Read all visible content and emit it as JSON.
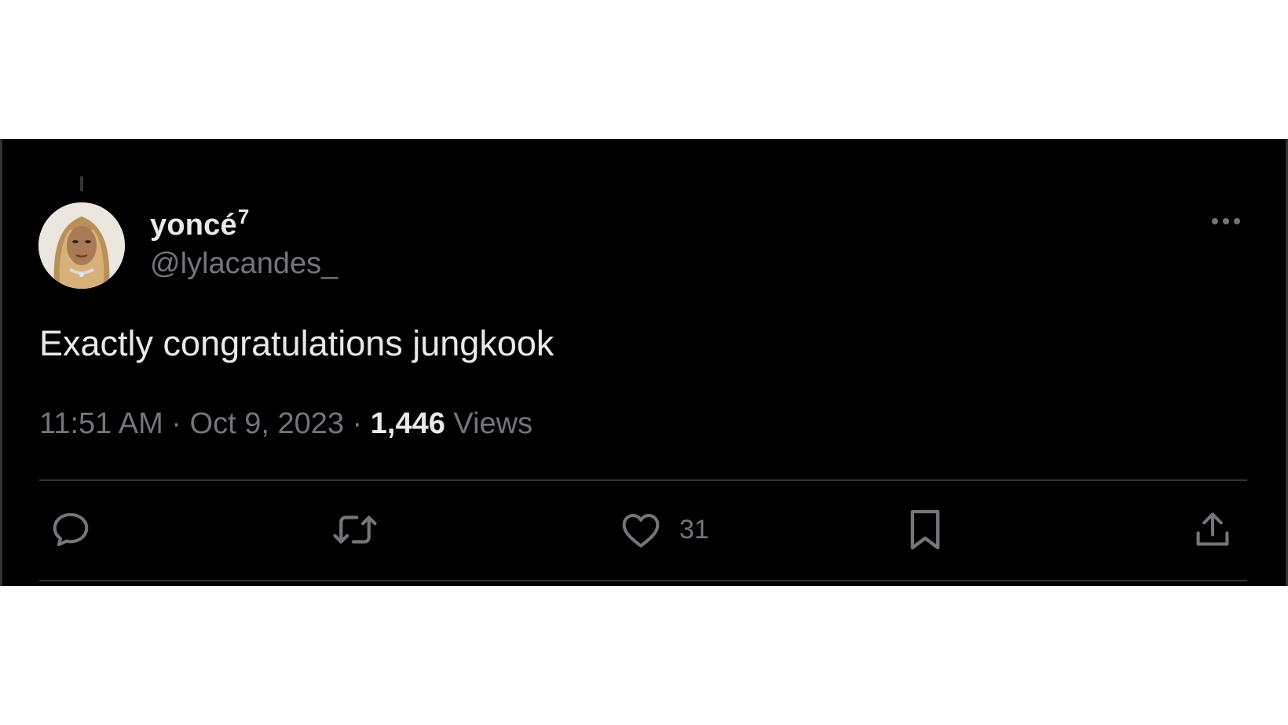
{
  "tweet": {
    "display_name": "yoncé",
    "display_name_superscript": "7",
    "handle": "@lylacandes_",
    "text": "Exactly congratulations jungkook",
    "time": "11:51 AM",
    "date": "Oct 9, 2023",
    "views_count": "1,446",
    "views_label": "Views"
  },
  "actions": {
    "reply_icon": "reply-icon",
    "retweet_icon": "retweet-icon",
    "like_icon": "heart-icon",
    "like_count": "31",
    "bookmark_icon": "bookmark-icon",
    "share_icon": "share-icon"
  },
  "colors": {
    "background": "#000000",
    "primary_text": "#e7e9ea",
    "secondary_text": "#71767b",
    "divider": "#2f3336"
  }
}
